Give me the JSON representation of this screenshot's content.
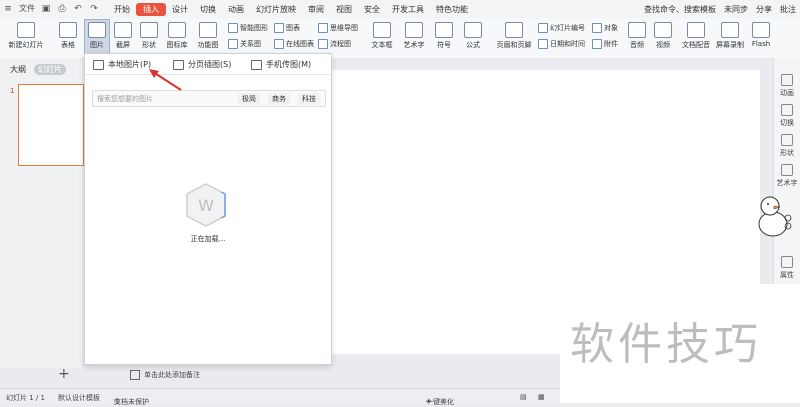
{
  "menubar": {
    "file_label": "文件",
    "tabs": [
      "开始",
      "插入",
      "设计",
      "切换",
      "动画",
      "幻灯片放映",
      "审阅",
      "视图",
      "安全",
      "开发工具",
      "特色功能"
    ],
    "active_tab_index": 1,
    "search_label": "查找命令、搜索模板",
    "sync_label": "未同步",
    "share_label": "分享",
    "comment_label": "批注"
  },
  "ribbon": {
    "new_slide": "新建幻灯片",
    "table": "表格",
    "picture": "图片",
    "screenshot": "截屏",
    "shape": "形状",
    "icon_library": "图标库",
    "function_chart": "功能图",
    "smart_graphic": "智能图形",
    "chart": "图表",
    "relation": "关系图",
    "online_chart": "在线图表",
    "mindmap": "思维导图",
    "flowchart": "流程图",
    "textbox": "文本框",
    "art_text": "艺术字",
    "symbol": "符号",
    "formula": "公式",
    "header_footer": "页眉和页脚",
    "slide_number": "幻灯片编号",
    "datetime": "日期和时间",
    "object": "对象",
    "attachment": "附件",
    "audio": "音频",
    "video": "视频",
    "doc_audio": "文档配音",
    "screen_record": "屏幕录制",
    "flash": "Flash"
  },
  "left_panel": {
    "outline_tab": "大纲",
    "slides_tab": "幻灯片",
    "slide_number": "1"
  },
  "popup": {
    "tab_local": "本地图片(P)",
    "tab_page": "分页插图(S)",
    "tab_phone": "手机传图(M)",
    "search_placeholder": "搜索您想要的图片",
    "tags": [
      "极简",
      "商务",
      "科技"
    ],
    "loading_text": "正在加载..."
  },
  "right_bar": {
    "items": [
      "动画",
      "切换",
      "形状",
      "艺术字",
      "属性"
    ]
  },
  "notes": {
    "placeholder": "单击此处添加备注"
  },
  "status": {
    "slide_counter": "幻灯片 1 / 1",
    "template": "默认设计模板",
    "protection": "文档未保护",
    "beautify": "一键美化"
  },
  "watermark": {
    "text": "软件技巧"
  },
  "colors": {
    "accent": "#e8543f",
    "thumb_border": "#e07b3c",
    "arrow": "#d9342b"
  }
}
